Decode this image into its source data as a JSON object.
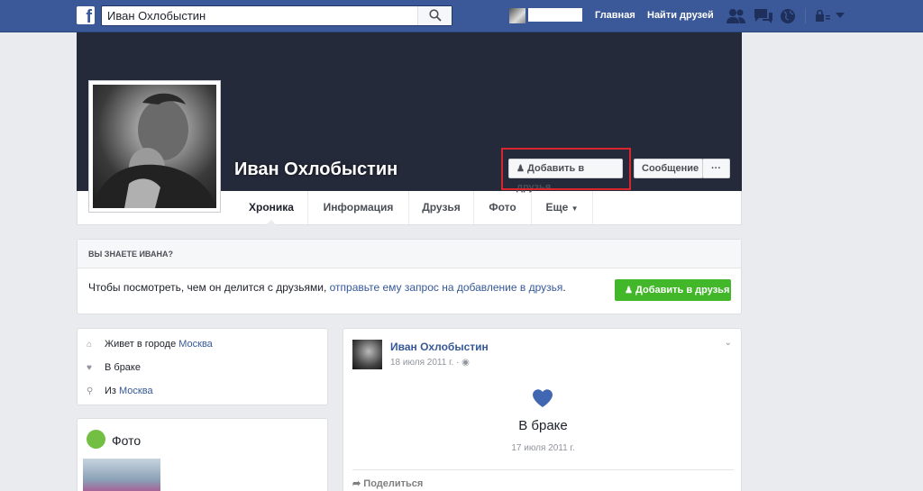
{
  "topbar": {
    "logo": "f",
    "search_value": "Иван Охлобыстин",
    "home_label": "Главная",
    "find_friends_label": "Найти друзей",
    "icons": [
      "friend-requests-icon",
      "messages-icon",
      "notifications-icon",
      "privacy-lock-icon",
      "dropdown-icon"
    ]
  },
  "profile": {
    "name": "Иван Охлобыстин",
    "add_friend_label": "Добавить в друзья",
    "message_label": "Сообщение",
    "more_label": "···"
  },
  "nav": {
    "tabs": [
      {
        "label": "Хроника"
      },
      {
        "label": "Информация"
      },
      {
        "label": "Друзья"
      },
      {
        "label": "Фото"
      },
      {
        "label": "Еще"
      }
    ]
  },
  "know_box": {
    "heading": "ВЫ ЗНАЕТЕ ИВАНА?",
    "text_before": "Чтобы посмотреть, чем он делится с друзьями, ",
    "text_link": "отправьте ему запрос на добавление в друзья",
    "text_after": ".",
    "button_label": "Добавить в друзья"
  },
  "intro": {
    "lives_prefix": "Живет в городе ",
    "lives_city": "Москва",
    "relationship": "В браке",
    "from_prefix": "Из ",
    "from_city": "Москва"
  },
  "photos": {
    "title": "Фото"
  },
  "post": {
    "author": "Иван Охлобыстин",
    "date": "18 июля 2011 г. · ",
    "status": "В браке",
    "sub_date": "17 июля 2011 г.",
    "share_label": "Поделиться"
  },
  "colors": {
    "brand": "#3b5998",
    "cover": "#252a3a",
    "link": "#365899",
    "green": "#42b72a",
    "highlight": "#d9262c",
    "heart": "#4267b2"
  }
}
